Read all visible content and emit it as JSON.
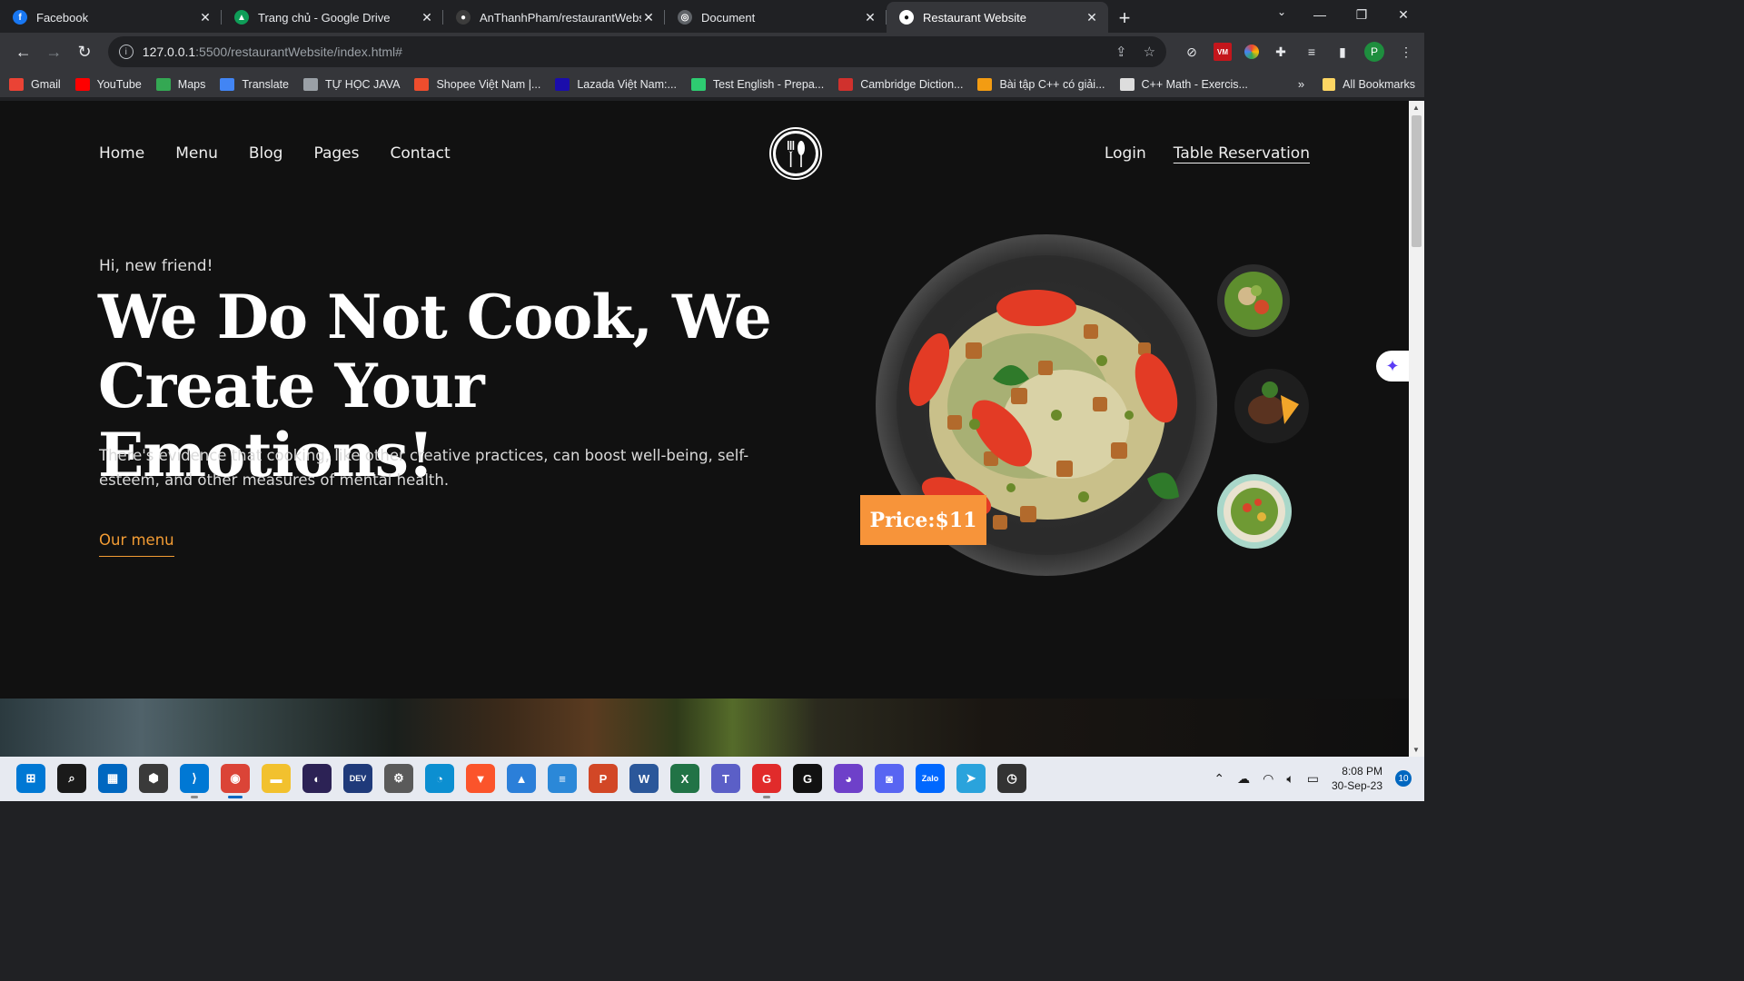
{
  "browser": {
    "tabs": [
      {
        "title": "Facebook",
        "favicon_color": "#1877f2",
        "favicon_glyph": "f"
      },
      {
        "title": "Trang chủ - Google Drive",
        "favicon_color": "#0f9d58",
        "favicon_glyph": "▲"
      },
      {
        "title": "AnThanhPham/restaurantWebsit",
        "favicon_color": "#3c3c3c",
        "favicon_glyph": "●"
      },
      {
        "title": "Document",
        "favicon_color": "#5f6368",
        "favicon_glyph": "◎"
      },
      {
        "title": "Restaurant Website",
        "favicon_color": "#ffffff",
        "favicon_glyph": "●",
        "active": true
      }
    ],
    "url_host": "127.0.0.1",
    "url_path": ":5500/restaurantWebsite/index.html#",
    "profile_initial": "P",
    "bookmarks": [
      {
        "label": "Gmail",
        "color": "#ea4335"
      },
      {
        "label": "YouTube",
        "color": "#ff0000"
      },
      {
        "label": "Maps",
        "color": "#34a853"
      },
      {
        "label": "Translate",
        "color": "#4285f4"
      },
      {
        "label": "TỰ HỌC JAVA",
        "color": "#9aa0a6"
      },
      {
        "label": "Shopee Việt Nam |...",
        "color": "#ee4d2d"
      },
      {
        "label": "Lazada Việt Nam:...",
        "color": "#1a0dab"
      },
      {
        "label": "Test English - Prepa...",
        "color": "#2ecc71"
      },
      {
        "label": "Cambridge Diction...",
        "color": "#d0312d"
      },
      {
        "label": "Bài tập C++ có giải...",
        "color": "#f39c12"
      },
      {
        "label": "C++ Math - Exercis...",
        "color": "#dddddd"
      }
    ],
    "bookmarks_more": "»",
    "all_bookmarks": "All Bookmarks"
  },
  "site": {
    "nav": [
      "Home",
      "Menu",
      "Blog",
      "Pages",
      "Contact"
    ],
    "login": "Login",
    "reservation": "Table Reservation",
    "greeting": "Hi, new friend!",
    "headline_line1": "We Do Not Cook, We",
    "headline_line2": "Create Your Emotions!",
    "description": "There's evidence that cooking, like other creative practices, can boost well-being, self-esteem, and other measures of mental health.",
    "cta": "Our menu",
    "price": "Price:$11",
    "accent_color": "#f7943a"
  },
  "taskbar": {
    "apps": [
      {
        "name": "windows-start-icon",
        "label": "⊞",
        "color": "#0078d4"
      },
      {
        "name": "search-icon",
        "label": "⌕",
        "color": "#1a1a1a"
      },
      {
        "name": "store-icon",
        "label": "▦",
        "color": "#0067c0"
      },
      {
        "name": "cube-app-icon",
        "label": "⬢",
        "color": "#3a3a3a"
      },
      {
        "name": "vscode-icon",
        "label": "⟩",
        "color": "#0078d4",
        "running": true
      },
      {
        "name": "chrome-icon",
        "label": "◉",
        "color": "#db4437",
        "active": true
      },
      {
        "name": "file-explorer-icon",
        "label": "▬",
        "color": "#f2c12e"
      },
      {
        "name": "eclipse-icon",
        "label": "◐",
        "color": "#2c2255"
      },
      {
        "name": "devc-icon",
        "label": "DEV",
        "color": "#1f3a7a"
      },
      {
        "name": "settings-icon",
        "label": "⚙",
        "color": "#5a5a5a"
      },
      {
        "name": "edge-icon",
        "label": "◔",
        "color": "#0c8fd1"
      },
      {
        "name": "brave-icon",
        "label": "▼",
        "color": "#fb542b"
      },
      {
        "name": "photos-icon",
        "label": "▲",
        "color": "#2b7fd9"
      },
      {
        "name": "notepad-icon",
        "label": "≡",
        "color": "#2b88d8"
      },
      {
        "name": "powerpoint-icon",
        "label": "P",
        "color": "#d24726"
      },
      {
        "name": "word-icon",
        "label": "W",
        "color": "#2b579a"
      },
      {
        "name": "excel-icon",
        "label": "X",
        "color": "#217346"
      },
      {
        "name": "teams-icon",
        "label": "T",
        "color": "#5b5fc7"
      },
      {
        "name": "garena-icon",
        "label": "G",
        "color": "#e12b2b",
        "running": true
      },
      {
        "name": "garena2-icon",
        "label": "G",
        "color": "#111111"
      },
      {
        "name": "github-icon",
        "label": "◕",
        "color": "#6e40c9"
      },
      {
        "name": "discord-icon",
        "label": "◙",
        "color": "#5865f2"
      },
      {
        "name": "zalo-icon",
        "label": "Zalo",
        "color": "#0068ff"
      },
      {
        "name": "telegram-icon",
        "label": "➤",
        "color": "#2aa3dc"
      },
      {
        "name": "clock-app-icon",
        "label": "◷",
        "color": "#333333"
      }
    ],
    "time": "8:08 PM",
    "date": "30-Sep-23",
    "notifications": "10"
  }
}
